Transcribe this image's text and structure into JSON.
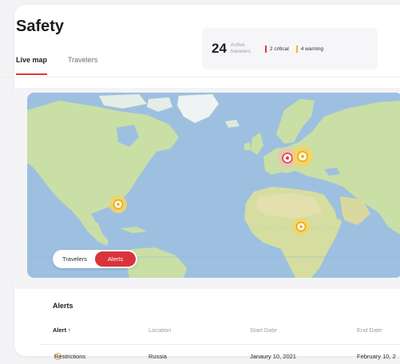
{
  "page": {
    "title": "Safety"
  },
  "tabs": [
    {
      "label": "Live map",
      "active": true
    },
    {
      "label": "Travelers",
      "active": false
    }
  ],
  "stats": {
    "active_count": "24",
    "active_label": "Active travelers",
    "critical": {
      "label": "2 critical",
      "color": "#e0383e"
    },
    "warning": {
      "label": "4 warning",
      "color": "#f2b630"
    }
  },
  "map": {
    "water_color": "#9ec0e0",
    "land_color": "#c9dfa5",
    "markers": [
      {
        "name": "marker-critical-germany",
        "severity": "critical",
        "icon": "alert-critical-icon"
      },
      {
        "name": "marker-warning-poland",
        "severity": "warning",
        "icon": "alert-warning-icon"
      },
      {
        "name": "marker-warning-texas",
        "severity": "warning",
        "icon": "alert-warning-icon"
      },
      {
        "name": "marker-warning-niger",
        "severity": "warning",
        "icon": "alert-warning-icon"
      }
    ]
  },
  "toggle": {
    "travelers_label": "Travelers",
    "alerts_label": "Alerts",
    "selected": "Alerts"
  },
  "alerts": {
    "title": "Alerts",
    "columns": [
      "Alert ↑",
      "Location",
      "Start Date",
      "End Date"
    ],
    "rows": [
      {
        "alert": "Restrictions",
        "location": "Russia",
        "start": "Janaury 10, 2021",
        "end": "February 10, 2",
        "icon": "warning-clock-icon"
      }
    ]
  }
}
